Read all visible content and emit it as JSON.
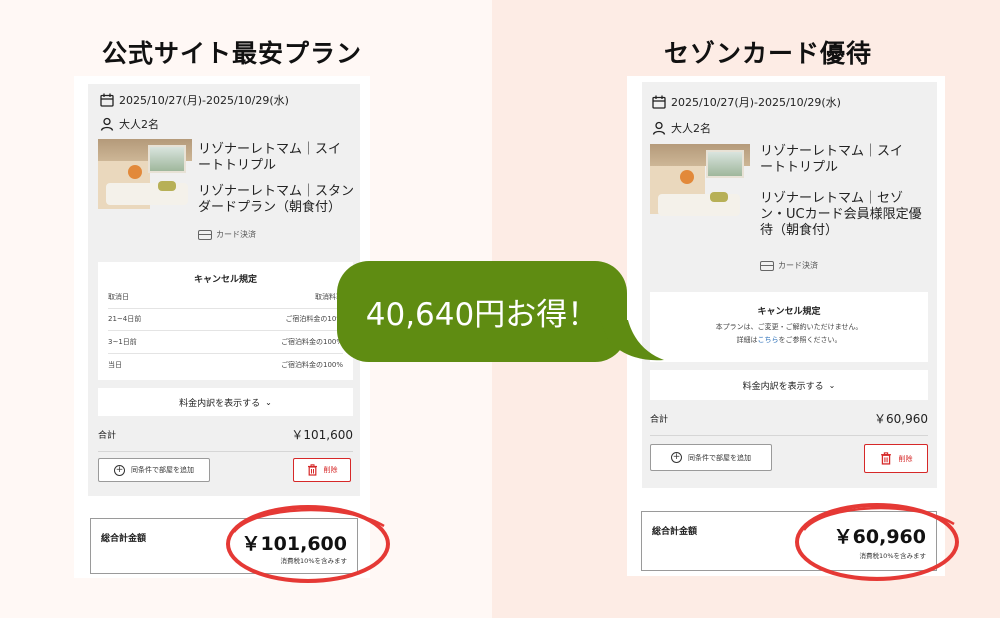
{
  "left": {
    "heading": "公式サイト最安プラン",
    "dates": "2025/10/27(月)-2025/10/29(水)",
    "guests": "大人2名",
    "room": [
      "リゾナーレトマム｜スイ",
      "ートトリプル"
    ],
    "plan": [
      "リゾナーレトマム｜スタン",
      "ダードプラン（朝食付）"
    ],
    "payment": "カード決済",
    "cancel": {
      "title": "キャンセル規定",
      "header": [
        "取消日",
        "取消料率"
      ],
      "rows": [
        [
          "21~4日前",
          "ご宿泊料金の10%"
        ],
        [
          "3~1日前",
          "ご宿泊料金の100%"
        ],
        [
          "当日",
          "ご宿泊料金の100%"
        ]
      ]
    },
    "breakdown": "料金内訳を表示する",
    "subtotal_label": "合計",
    "subtotal": "￥101,600",
    "add_room": "同条件で部屋を追加",
    "delete": "削除",
    "grand_label": "総合計金額",
    "grand_amount": "￥101,600",
    "tax": "消費税10%を含みます"
  },
  "right": {
    "heading": "セゾンカード優待",
    "dates": "2025/10/27(月)-2025/10/29(水)",
    "guests": "大人2名",
    "room": [
      "リゾナーレトマム｜スイ",
      "ートトリプル"
    ],
    "plan": [
      "リゾナーレトマム｜セゾ",
      "ン・UCカード会員様限定優",
      "待（朝食付）"
    ],
    "payment": "カード決済",
    "cancel": {
      "title": "キャンセル規定",
      "note1": "本プランは、ご変更・ご解約いただけません。",
      "note2_pre": "詳細は",
      "note2_link": "こちら",
      "note2_post": "をご参照ください。"
    },
    "breakdown": "料金内訳を表示する",
    "subtotal_label": "合計",
    "subtotal": "￥60,960",
    "add_room": "同条件で部屋を追加",
    "delete": "削除",
    "grand_label": "総合計金額",
    "grand_amount": "￥60,960",
    "tax": "消費税10%を含みます"
  },
  "callout": "40,640円お得！",
  "colors": {
    "callout_bg": "#5f8c12",
    "highlight": "#e53935",
    "delete": "#d62828",
    "left_bg": "#fff8f5",
    "right_bg": "#fdece5"
  }
}
